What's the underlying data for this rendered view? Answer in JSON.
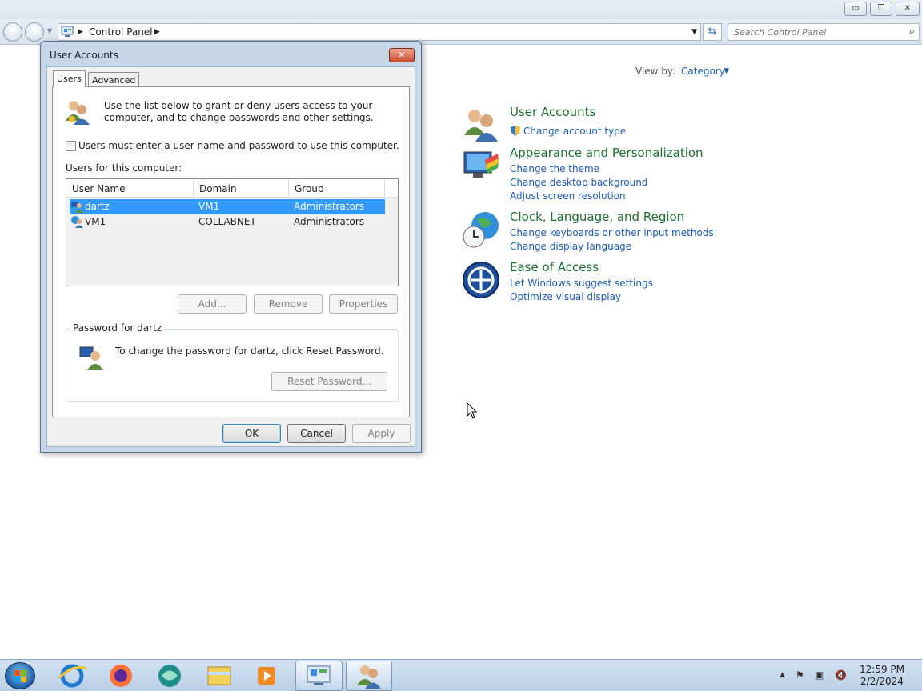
{
  "control_panel": {
    "breadcrumb": "Control Panel",
    "search_placeholder": "Search Control Panel",
    "view_by_label": "View by:",
    "view_by_value": "Category",
    "categories": [
      {
        "title": "User Accounts",
        "links": [
          "Change account type"
        ]
      },
      {
        "title": "Appearance and Personalization",
        "links": [
          "Change the theme",
          "Change desktop background",
          "Adjust screen resolution"
        ]
      },
      {
        "title": "Clock, Language, and Region",
        "links": [
          "Change keyboards or other input methods",
          "Change display language"
        ]
      },
      {
        "title": "Ease of Access",
        "links": [
          "Let Windows suggest settings",
          "Optimize visual display"
        ]
      }
    ]
  },
  "dialog": {
    "title": "User Accounts",
    "tabs": [
      "Users",
      "Advanced"
    ],
    "intro_text": "Use the list below to grant or deny users access to your computer, and to change passwords and other settings.",
    "checkbox_label": "Users must enter a user name and password to use this computer.",
    "checkbox_checked": false,
    "users_label": "Users for this computer:",
    "columns": [
      "User Name",
      "Domain",
      "Group"
    ],
    "users": [
      {
        "name": "dartz",
        "domain": "VM1",
        "group": "Administrators",
        "selected": true
      },
      {
        "name": "VM1",
        "domain": "COLLABNET",
        "group": "Administrators",
        "selected": false
      }
    ],
    "buttons": {
      "add": "Add...",
      "remove": "Remove",
      "properties": "Properties",
      "reset_password": "Reset Password...",
      "ok": "OK",
      "cancel": "Cancel",
      "apply": "Apply"
    },
    "password_group_title": "Password for dartz",
    "password_text": "To change the password for dartz, click Reset Password."
  },
  "taskbar": {
    "time": "12:59 PM",
    "date": "2/2/2024"
  },
  "colors": {
    "category_title": "#1e6e34",
    "link": "#1e5ab4",
    "selection": "#3399ff"
  }
}
